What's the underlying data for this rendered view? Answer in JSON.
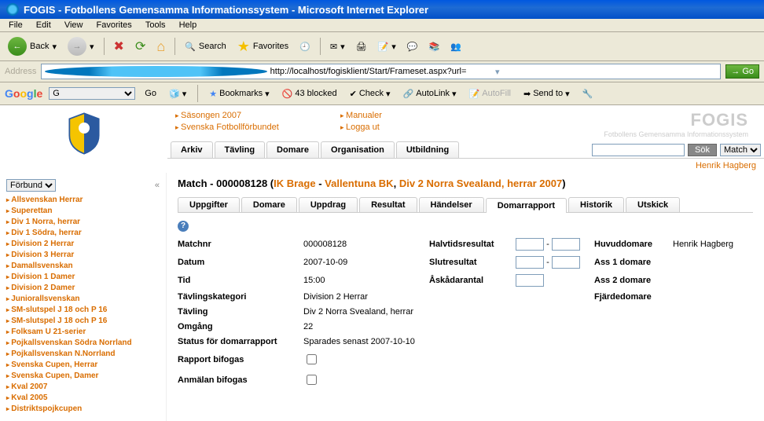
{
  "window": {
    "title": "FOGIS - Fotbollens Gemensamma Informationssystem - Microsoft Internet Explorer"
  },
  "menu": {
    "file": "File",
    "edit": "Edit",
    "view": "View",
    "favorites": "Favorites",
    "tools": "Tools",
    "help": "Help"
  },
  "toolbar": {
    "back": "Back",
    "search": "Search",
    "favorites": "Favorites"
  },
  "address": {
    "label": "Address",
    "url": "http://localhost/fogisklient/Start/Frameset.aspx?url=",
    "go": "Go"
  },
  "google": {
    "label": "Google",
    "go": "Go",
    "bookmarks": "Bookmarks",
    "blocked": "43 blocked",
    "check": "Check",
    "autolink": "AutoLink",
    "autofill": "AutoFill",
    "sendto": "Send to"
  },
  "brand": {
    "title": "FOGIS",
    "sub": "Fotbollens Gemensamma Informationssystem"
  },
  "toplinks": {
    "col1": {
      "a": "Säsongen 2007",
      "b": "Svenska Fotbollförbundet"
    },
    "col2": {
      "a": "Manualer",
      "b": "Logga ut"
    }
  },
  "navtabs": {
    "arkiv": "Arkiv",
    "tavling": "Tävling",
    "domare": "Domare",
    "organisation": "Organisation",
    "utbildning": "Utbildning"
  },
  "search": {
    "button": "Sök",
    "mode": "Match"
  },
  "user": "Henrik Hagberg",
  "sidebar": {
    "select": "Förbund",
    "links": [
      "Allsvenskan Herrar",
      "Superettan",
      "Div 1 Norra, herrar",
      "Div 1 Södra, herrar",
      "Division 2 Herrar",
      "Division 3 Herrar",
      "Damallsvenskan",
      "Division 1 Damer",
      "Division 2 Damer",
      "Juniorallsvenskan",
      "SM-slutspel J 18 och P 16",
      "SM-slutspel J 18 och P 16",
      "Folksam U 21-serier",
      "Pojkallsvenskan Södra Norrland",
      "Pojkallsvenskan N.Norrland",
      "Svenska Cupen, Herrar",
      "Svenska Cupen, Damer",
      "Kval 2007",
      "Kval 2005",
      "Distriktspojkcupen"
    ]
  },
  "page": {
    "prefix": "Match - 000008128 (",
    "team1": "IK Brage",
    "sepTeam": " - ",
    "team2": "Vallentuna BK",
    "sepLeague": ", ",
    "league": "Div 2 Norra Svealand, herrar 2007",
    "suffix": ")"
  },
  "subtabs": {
    "uppgifter": "Uppgifter",
    "domare": "Domare",
    "uppdrag": "Uppdrag",
    "resultat": "Resultat",
    "handelser": "Händelser",
    "domarrapport": "Domarrapport",
    "historik": "Historik",
    "utskick": "Utskick"
  },
  "form": {
    "matchnr_lbl": "Matchnr",
    "matchnr_val": "000008128",
    "datum_lbl": "Datum",
    "datum_val": "2007-10-09",
    "tid_lbl": "Tid",
    "tid_val": "15:00",
    "kat_lbl": "Tävlingskategori",
    "kat_val": "Division 2 Herrar",
    "tavling_lbl": "Tävling",
    "tavling_val": "Div 2 Norra Svealand, herrar",
    "omgang_lbl": "Omgång",
    "omgang_val": "22",
    "status_lbl": "Status för domarrapport",
    "status_val": "Sparades senast 2007-10-10",
    "rapport_lbl": "Rapport bifogas",
    "anmalan_lbl": "Anmälan bifogas",
    "halvtid_lbl": "Halvtidsresultat",
    "slut_lbl": "Slutresultat",
    "askadar_lbl": "Åskådarantal",
    "huvud_lbl": "Huvuddomare",
    "huvud_val": "Henrik Hagberg",
    "ass1_lbl": "Ass 1 domare",
    "ass2_lbl": "Ass 2 domare",
    "fjarde_lbl": "Fjärdedomare",
    "dash": "-"
  }
}
